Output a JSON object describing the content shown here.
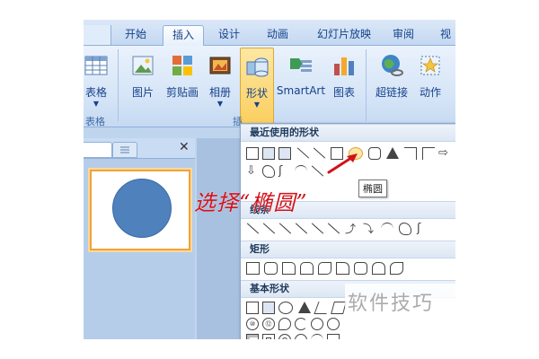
{
  "ribbon": {
    "tabs": [
      {
        "label": "开始",
        "active": false
      },
      {
        "label": "插入",
        "active": true
      },
      {
        "label": "设计",
        "active": false
      },
      {
        "label": "动画",
        "active": false
      },
      {
        "label": "幻灯片放映",
        "active": false
      },
      {
        "label": "审阅",
        "active": false
      },
      {
        "label": "视",
        "active": false
      }
    ],
    "buttons": {
      "table": "表格",
      "picture": "图片",
      "clipart": "剪贴画",
      "album": "相册",
      "shapes": "形状",
      "smartart": "SmartArt",
      "chart": "图表",
      "hyperlink": "超链接",
      "action": "动作"
    },
    "group_table": "表格",
    "group_illustrations_partial": "插"
  },
  "shapes_menu": {
    "sections": {
      "recent": "最近使用的形状",
      "lines": "线条",
      "rectangles": "矩形",
      "basic": "基本形状"
    },
    "tooltip": "椭圆"
  },
  "annotation": "选择“椭圆”",
  "watermark": "软件技巧",
  "colors": {
    "ribbon_blue": "#c4d8f1",
    "selected_button": "#fbcf5f",
    "annotation_red": "#d2121a",
    "oval_fill": "#4f81bd"
  }
}
